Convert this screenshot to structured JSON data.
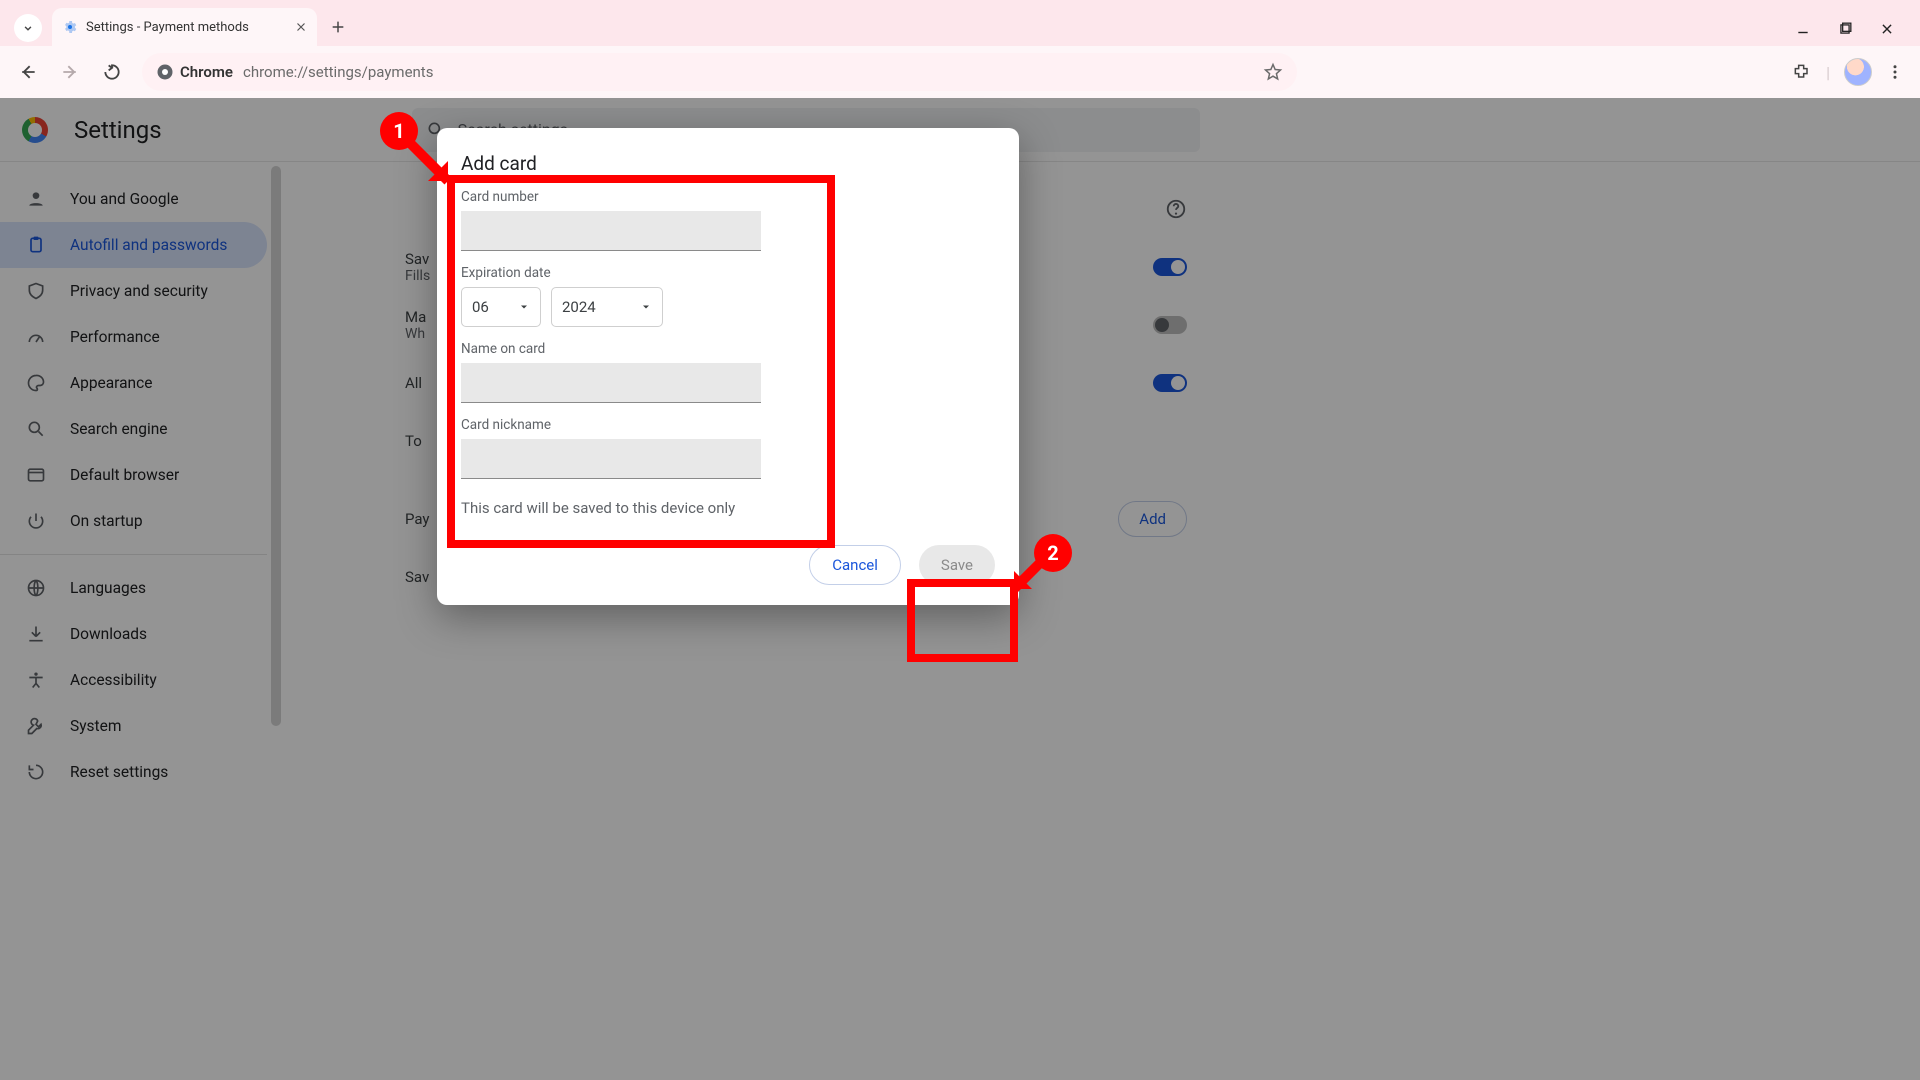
{
  "browser": {
    "tab_title": "Settings - Payment methods",
    "omnibox_chip": "Chrome",
    "url": "chrome://settings/payments"
  },
  "app": {
    "title": "Settings",
    "search_placeholder": "Search settings"
  },
  "sidebar": {
    "items": [
      {
        "label": "You and Google"
      },
      {
        "label": "Autofill and passwords"
      },
      {
        "label": "Privacy and security"
      },
      {
        "label": "Performance"
      },
      {
        "label": "Appearance"
      },
      {
        "label": "Search engine"
      },
      {
        "label": "Default browser"
      },
      {
        "label": "On startup"
      },
      {
        "label": "Languages"
      },
      {
        "label": "Downloads"
      },
      {
        "label": "Accessibility"
      },
      {
        "label": "System"
      },
      {
        "label": "Reset settings"
      }
    ]
  },
  "content": {
    "row_save_prefix": "Sav",
    "row_fill_prefix": "Fills",
    "row_manual_prefix": "Ma",
    "row_manual_sub_prefix": "Wh",
    "row_allow_prefix": "All",
    "row_to_prefix": "To",
    "section_pay_prefix": "Pay",
    "row_sav2_prefix": "Sav",
    "add_button": "Add"
  },
  "dialog": {
    "title": "Add card",
    "card_number_label": "Card number",
    "expiration_label": "Expiration date",
    "exp_month": "06",
    "exp_year": "2024",
    "name_label": "Name on card",
    "nickname_label": "Card nickname",
    "note": "This card will be saved to this device only",
    "cancel": "Cancel",
    "save": "Save"
  },
  "annotations": {
    "b1": "1",
    "b2": "2"
  }
}
